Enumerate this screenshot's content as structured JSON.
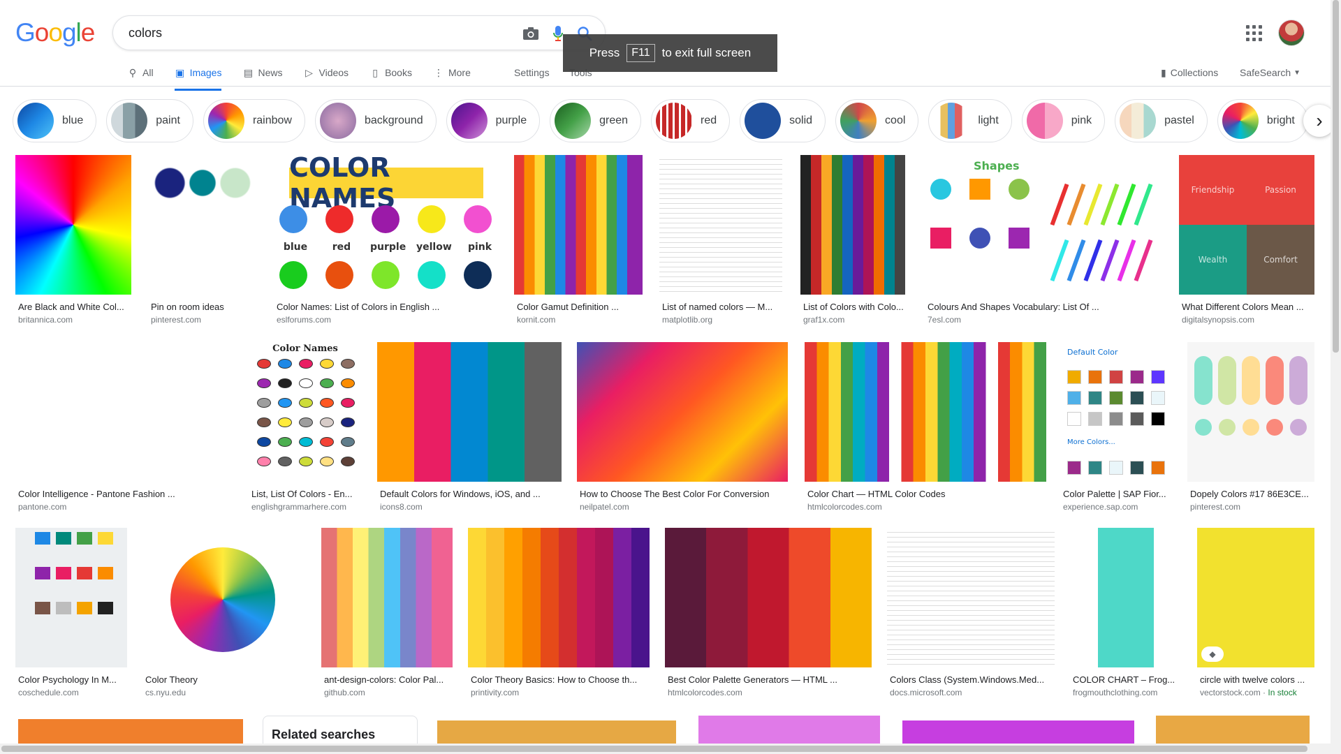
{
  "logo": {
    "letters": [
      "G",
      "o",
      "o",
      "g",
      "l",
      "e"
    ],
    "colors": [
      "#4285F4",
      "#EA4335",
      "#FBBC05",
      "#4285F4",
      "#34A853",
      "#EA4335"
    ]
  },
  "search": {
    "value": "colors",
    "icons": [
      "camera-icon",
      "microphone-icon",
      "search-icon"
    ]
  },
  "tabs": [
    {
      "label": "All",
      "icon": "search-icon"
    },
    {
      "label": "Images",
      "icon": "image-icon",
      "active": true
    },
    {
      "label": "News",
      "icon": "news-icon"
    },
    {
      "label": "Videos",
      "icon": "video-icon"
    },
    {
      "label": "Books",
      "icon": "book-icon"
    },
    {
      "label": "More",
      "icon": "more-icon"
    }
  ],
  "settings_label": "Settings",
  "tools_label": "Tools",
  "collections_label": "Collections",
  "safesearch_label": "SafeSearch",
  "f11": {
    "press": "Press",
    "key": "F11",
    "rest": "to exit full screen"
  },
  "chips": [
    {
      "label": "blue",
      "color": "#1e5aa8"
    },
    {
      "label": "paint",
      "color": "#8aa0a6"
    },
    {
      "label": "rainbow",
      "color": "#f06292"
    },
    {
      "label": "background",
      "color": "#b07aa8"
    },
    {
      "label": "purple",
      "color": "#6a2a8a"
    },
    {
      "label": "green",
      "color": "#2e7d32"
    },
    {
      "label": "red",
      "color": "#c62828"
    },
    {
      "label": "solid",
      "color": "#1f4f9c"
    },
    {
      "label": "cool",
      "color": "#d04848"
    },
    {
      "label": "light",
      "color": "#e8c060"
    },
    {
      "label": "pink",
      "color": "#f06aa8"
    },
    {
      "label": "pastel",
      "color": "#f3d6b8"
    },
    {
      "label": "bright",
      "color": "#7c4dff"
    }
  ],
  "results": [
    {
      "title": "Are Black and White Col...",
      "source": "britannica.com"
    },
    {
      "title": "Pin on room ideas",
      "source": "pinterest.com"
    },
    {
      "title": "Color Names: List of Colors in English ...",
      "source": "eslforums.com"
    },
    {
      "title": "Color Gamut Definition ...",
      "source": "kornit.com"
    },
    {
      "title": "List of named colors — M...",
      "source": "matplotlib.org"
    },
    {
      "title": "List of Colors with Colo...",
      "source": "graf1x.com"
    },
    {
      "title": "Colours And Shapes Vocabulary: List Of ...",
      "source": "7esl.com"
    },
    {
      "title": "What Different Colors Mean ...",
      "source": "digitalsynopsis.com"
    },
    {
      "title": "Color Intelligence - Pantone Fashion ...",
      "source": "pantone.com"
    },
    {
      "title": "List, List Of Colors - En...",
      "source": "englishgrammarhere.com"
    },
    {
      "title": "Default Colors for Windows, iOS, and ...",
      "source": "icons8.com"
    },
    {
      "title": "How to Choose The Best Color For Conversion",
      "source": "neilpatel.com"
    },
    {
      "title": "Color Chart — HTML Color Codes",
      "source": "htmlcolorcodes.com"
    },
    {
      "title": "Color Palette | SAP Fior...",
      "source": "experience.sap.com"
    },
    {
      "title": "Dopely Colors #17 86E3CE...",
      "source": "pinterest.com"
    },
    {
      "title": "Color Psychology In M...",
      "source": "coschedule.com"
    },
    {
      "title": "Color Theory",
      "source": "cs.nyu.edu"
    },
    {
      "title": "ant-design-colors: Color Pal...",
      "source": "github.com"
    },
    {
      "title": "Color Theory Basics: How to Choose th...",
      "source": "printivity.com"
    },
    {
      "title": "Best Color Palette Generators — HTML ...",
      "source": "htmlcolorcodes.com"
    },
    {
      "title": "Colors Class (System.Windows.Med...",
      "source": "docs.microsoft.com"
    },
    {
      "title": "COLOR CHART – Frog...",
      "source": "frogmouthclothing.com"
    },
    {
      "title": "circle with twelve colors ...",
      "source": "vectorstock.com",
      "stock": "In stock"
    }
  ],
  "image_texts": {
    "color_names": "COLOR NAMES",
    "color_names_words": [
      "blue",
      "red",
      "purple",
      "yellow",
      "pink"
    ],
    "list_of_colors_header": "Color Names",
    "shapes": "Shapes",
    "meaning_words": [
      "Friendship",
      "Passion",
      "Wealth",
      "Comfort"
    ],
    "sap_default": "Default Color",
    "sap_more": "More Colors..."
  },
  "related_label": "Related searches"
}
